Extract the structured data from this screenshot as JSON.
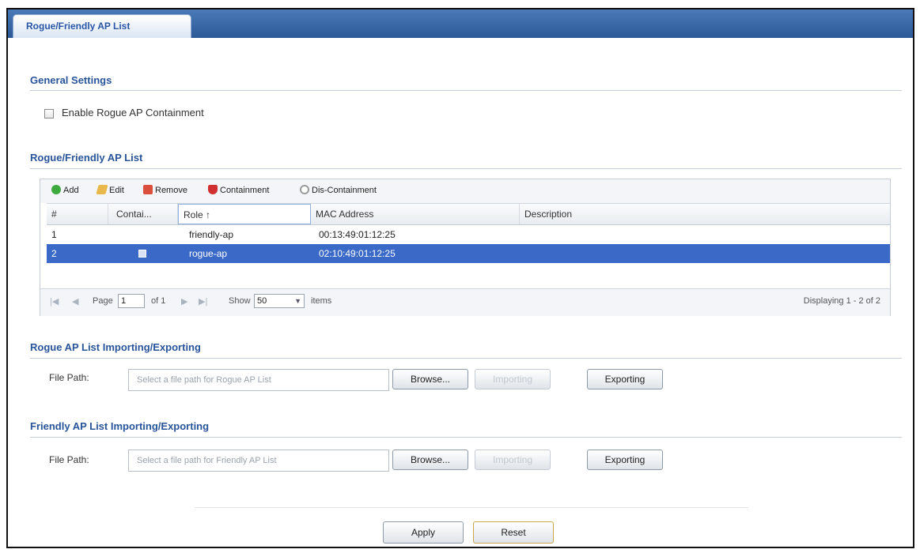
{
  "tab": {
    "label": "Rogue/Friendly AP List"
  },
  "general": {
    "title": "General Settings",
    "containment_label": "Enable Rogue AP Containment"
  },
  "ap_list": {
    "title": "Rogue/Friendly AP List",
    "toolbar": {
      "add": "Add",
      "edit": "Edit",
      "remove": "Remove",
      "containment": "Containment",
      "discontainment": "Dis-Containment"
    },
    "columns": [
      "#",
      "Contai...",
      "Role ↑",
      "MAC Address",
      "Description"
    ],
    "rows": [
      {
        "num": "1",
        "contained": false,
        "role": "friendly-ap",
        "mac": "00:13:49:01:12:25",
        "description": "",
        "selected": false
      },
      {
        "num": "2",
        "contained": true,
        "role": "rogue-ap",
        "mac": "02:10:49:01:12:25",
        "description": "",
        "selected": true
      }
    ],
    "pager": {
      "page_label": "Page",
      "page_value": "1",
      "of_label": "of 1",
      "show_label": "Show",
      "show_value": "50",
      "items_label": "items",
      "displaying": "Displaying 1 - 2 of 2"
    }
  },
  "rogue_import": {
    "title": "Rogue AP List Importing/Exporting",
    "file_path_label": "File Path:",
    "placeholder": "Select a file path for Rogue AP List",
    "browse": "Browse...",
    "importing": "Importing",
    "exporting": "Exporting"
  },
  "friendly_import": {
    "title": "Friendly AP List Importing/Exporting",
    "file_path_label": "File Path:",
    "placeholder": "Select a file path for Friendly AP List",
    "browse": "Browse...",
    "importing": "Importing",
    "exporting": "Exporting"
  },
  "footer": {
    "apply": "Apply",
    "reset": "Reset"
  },
  "colors": {
    "tab_bar": "#2c5a98",
    "section_title": "#28549a",
    "selected_row": "#3a69c7"
  }
}
